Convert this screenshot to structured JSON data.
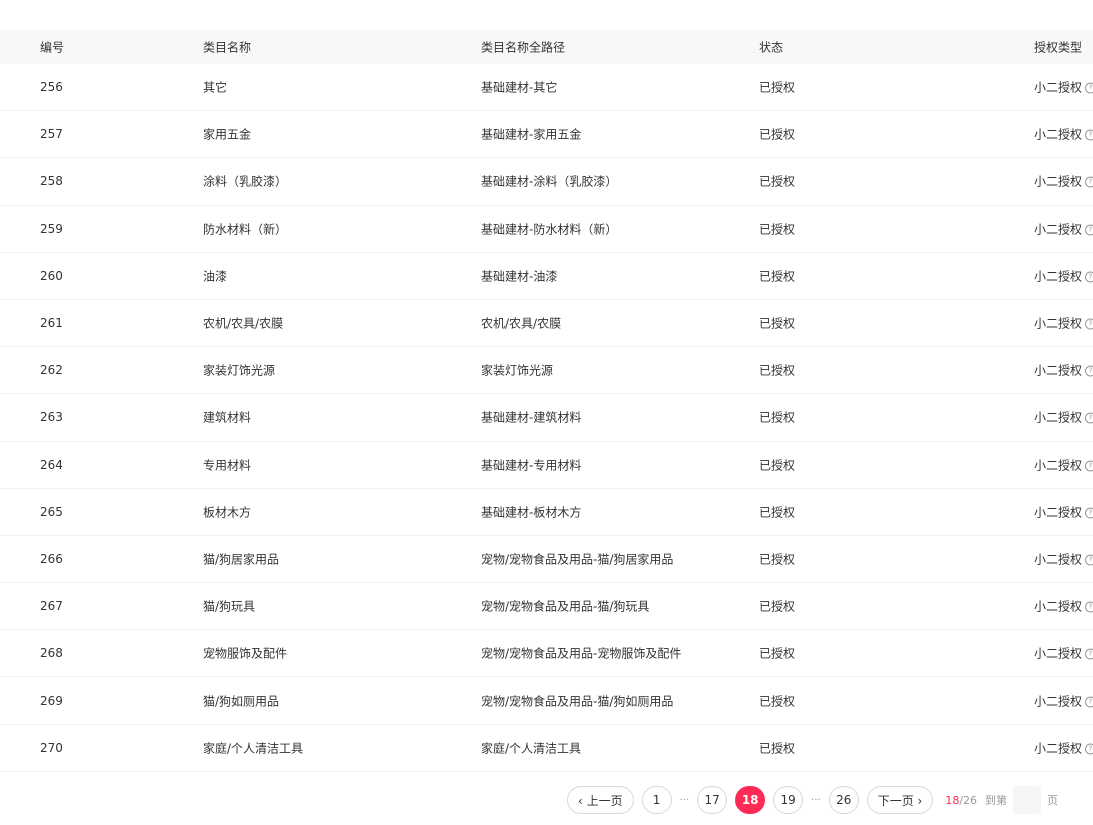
{
  "table": {
    "headers": {
      "id": "编号",
      "name": "类目名称",
      "path": "类目名称全路径",
      "status": "状态",
      "auth": "授权类型"
    },
    "rows": [
      {
        "id": "256",
        "name": "其它",
        "path": "基础建材-其它",
        "status": "已授权",
        "auth": "小二授权"
      },
      {
        "id": "257",
        "name": "家用五金",
        "path": "基础建材-家用五金",
        "status": "已授权",
        "auth": "小二授权"
      },
      {
        "id": "258",
        "name": "涂料（乳胶漆）",
        "path": "基础建材-涂料（乳胶漆）",
        "status": "已授权",
        "auth": "小二授权"
      },
      {
        "id": "259",
        "name": "防水材料（新）",
        "path": "基础建材-防水材料（新）",
        "status": "已授权",
        "auth": "小二授权"
      },
      {
        "id": "260",
        "name": "油漆",
        "path": "基础建材-油漆",
        "status": "已授权",
        "auth": "小二授权"
      },
      {
        "id": "261",
        "name": "农机/农具/农膜",
        "path": "农机/农具/农膜",
        "status": "已授权",
        "auth": "小二授权"
      },
      {
        "id": "262",
        "name": "家装灯饰光源",
        "path": "家装灯饰光源",
        "status": "已授权",
        "auth": "小二授权"
      },
      {
        "id": "263",
        "name": "建筑材料",
        "path": "基础建材-建筑材料",
        "status": "已授权",
        "auth": "小二授权"
      },
      {
        "id": "264",
        "name": "专用材料",
        "path": "基础建材-专用材料",
        "status": "已授权",
        "auth": "小二授权"
      },
      {
        "id": "265",
        "name": "板材木方",
        "path": "基础建材-板材木方",
        "status": "已授权",
        "auth": "小二授权"
      },
      {
        "id": "266",
        "name": "猫/狗居家用品",
        "path": "宠物/宠物食品及用品-猫/狗居家用品",
        "status": "已授权",
        "auth": "小二授权"
      },
      {
        "id": "267",
        "name": "猫/狗玩具",
        "path": "宠物/宠物食品及用品-猫/狗玩具",
        "status": "已授权",
        "auth": "小二授权"
      },
      {
        "id": "268",
        "name": "宠物服饰及配件",
        "path": "宠物/宠物食品及用品-宠物服饰及配件",
        "status": "已授权",
        "auth": "小二授权"
      },
      {
        "id": "269",
        "name": "猫/狗如厕用品",
        "path": "宠物/宠物食品及用品-猫/狗如厕用品",
        "status": "已授权",
        "auth": "小二授权"
      },
      {
        "id": "270",
        "name": "家庭/个人清洁工具",
        "path": "家庭/个人清洁工具",
        "status": "已授权",
        "auth": "小二授权"
      }
    ]
  },
  "pagination": {
    "prev_label": "‹ 上一页",
    "next_label": "下一页 ›",
    "pages": [
      "1",
      "17",
      "18",
      "19",
      "26"
    ],
    "current": "18",
    "ellipsis": "···",
    "info_current": "18",
    "info_total": "/26",
    "goto_label": "到第",
    "unit_label": "页"
  },
  "icons": {
    "help": "question-circle-icon"
  },
  "colors": {
    "accent": "#ff2b55",
    "header_bg": "#f7f8fa"
  }
}
